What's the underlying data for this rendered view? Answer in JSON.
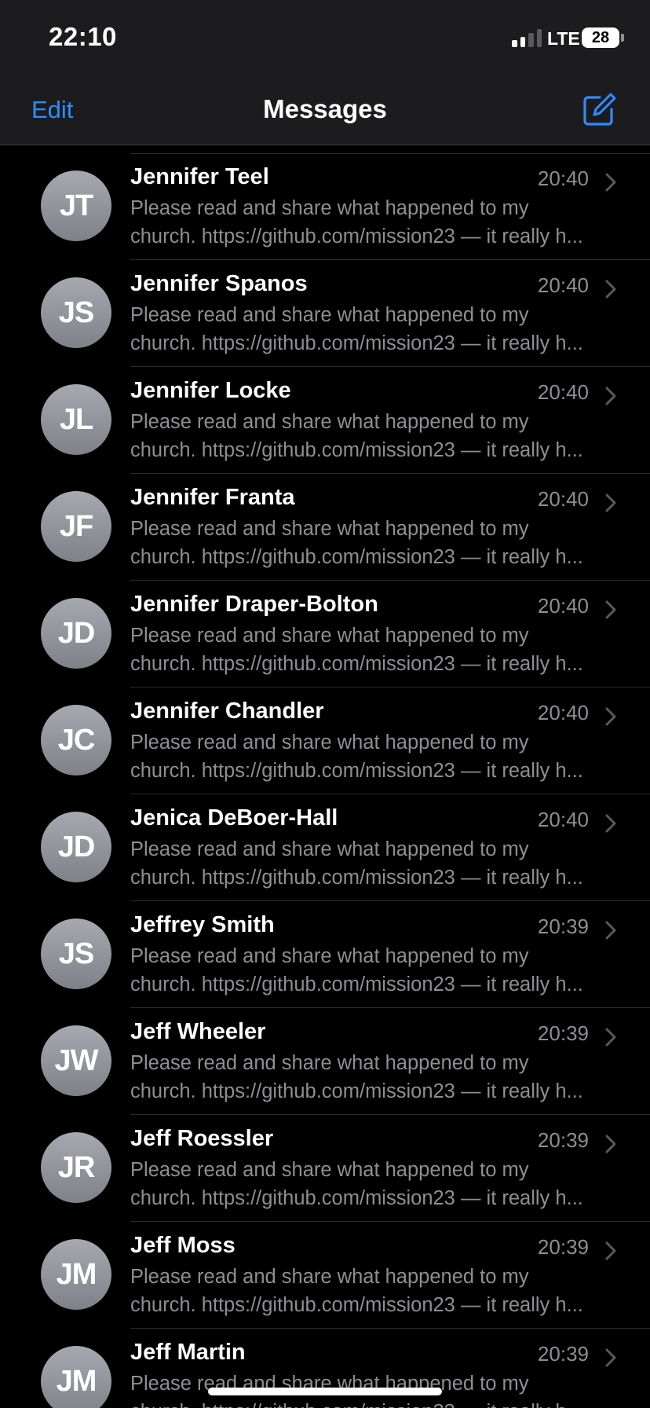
{
  "status_bar": {
    "time": "22:10",
    "network": "LTE",
    "battery": "28",
    "battery_level": 0.28,
    "signal_bars_active": 2,
    "signal_bars_total": 4
  },
  "nav": {
    "edit_label": "Edit",
    "title": "Messages",
    "compose_icon": "compose-icon"
  },
  "colors": {
    "accent": "#2f8cff",
    "background": "#000000",
    "bar": "#1c1c1e",
    "secondary_text": "#8e8e93",
    "avatar": "#9a9ca3"
  },
  "conversations": [
    {
      "initials": "JT",
      "name": "Jennifer Teel",
      "time": "20:40",
      "preview_line1": "Please read and share what happened to my",
      "preview_line2": "church. https://github.com/mission23 — it really h..."
    },
    {
      "initials": "JS",
      "name": "Jennifer Spanos",
      "time": "20:40",
      "preview_line1": "Please read and share what happened to my",
      "preview_line2": "church. https://github.com/mission23 — it really h..."
    },
    {
      "initials": "JL",
      "name": "Jennifer Locke",
      "time": "20:40",
      "preview_line1": "Please read and share what happened to my",
      "preview_line2": "church. https://github.com/mission23 — it really h..."
    },
    {
      "initials": "JF",
      "name": "Jennifer Franta",
      "time": "20:40",
      "preview_line1": "Please read and share what happened to my",
      "preview_line2": "church. https://github.com/mission23 — it really h..."
    },
    {
      "initials": "JD",
      "name": "Jennifer Draper-Bolton",
      "time": "20:40",
      "preview_line1": "Please read and share what happened to my",
      "preview_line2": "church. https://github.com/mission23 — it really h..."
    },
    {
      "initials": "JC",
      "name": "Jennifer Chandler",
      "time": "20:40",
      "preview_line1": "Please read and share what happened to my",
      "preview_line2": "church. https://github.com/mission23 — it really h..."
    },
    {
      "initials": "JD",
      "name": "Jenica DeBoer-Hall",
      "time": "20:40",
      "preview_line1": "Please read and share what happened to my",
      "preview_line2": "church. https://github.com/mission23 — it really h..."
    },
    {
      "initials": "JS",
      "name": "Jeffrey Smith",
      "time": "20:39",
      "preview_line1": "Please read and share what happened to my",
      "preview_line2": "church. https://github.com/mission23 — it really h..."
    },
    {
      "initials": "JW",
      "name": "Jeff Wheeler",
      "time": "20:39",
      "preview_line1": "Please read and share what happened to my",
      "preview_line2": "church. https://github.com/mission23 — it really h..."
    },
    {
      "initials": "JR",
      "name": "Jeff Roessler",
      "time": "20:39",
      "preview_line1": "Please read and share what happened to my",
      "preview_line2": "church. https://github.com/mission23 — it really h..."
    },
    {
      "initials": "JM",
      "name": "Jeff Moss",
      "time": "20:39",
      "preview_line1": "Please read and share what happened to my",
      "preview_line2": "church. https://github.com/mission23 — it really h..."
    },
    {
      "initials": "JM",
      "name": "Jeff Martin",
      "time": "20:39",
      "preview_line1": "Please read and share what happened to my",
      "preview_line2": "church. https://github.com/mission23 — it really h..."
    }
  ]
}
